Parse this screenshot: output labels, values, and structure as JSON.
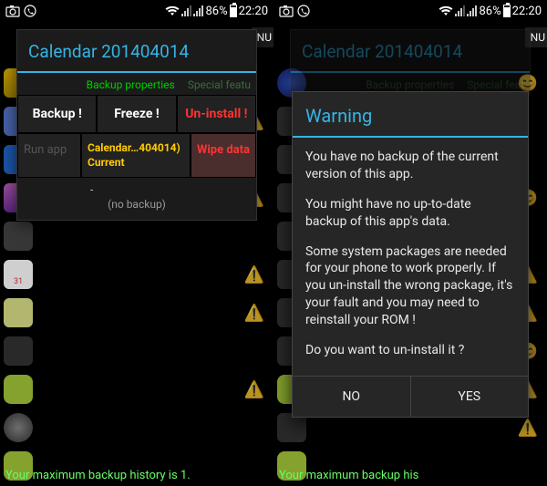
{
  "statusbar": {
    "battery_pct": "86%",
    "time": "22:20"
  },
  "nu_label": "NU",
  "dialog": {
    "title": "Calendar 201404014",
    "tabs": {
      "active": "Backup properties",
      "inactive": "Special featu"
    },
    "buttons": {
      "backup": "Backup !",
      "freeze": "Freeze !",
      "uninstall": "Un-install !"
    },
    "row2": {
      "runapp": "Run app",
      "current_line1": "Calendar…404014)",
      "current_line2": "Current",
      "wipe": "Wipe data"
    },
    "no_backup_dash": "-",
    "no_backup": "(no backup)"
  },
  "right_dialog_tabs": {
    "active": "Backup properties",
    "inactive": "Special feat"
  },
  "warning": {
    "title": "Warning",
    "p1": "You have no backup of the current version of this app.",
    "p2": "You might have no up-to-date backup of this app's data.",
    "p3": "Some system packages are needed for your phone to work properly. If you un-install the wrong package, it's your fault and you may need to reinstall your ROM !",
    "p4": "Do you want to un-install it ?",
    "no": "NO",
    "yes": "YES"
  },
  "status_msg": "Your maximum backup history is 1.",
  "status_msg_right": "Your maximum backup his"
}
